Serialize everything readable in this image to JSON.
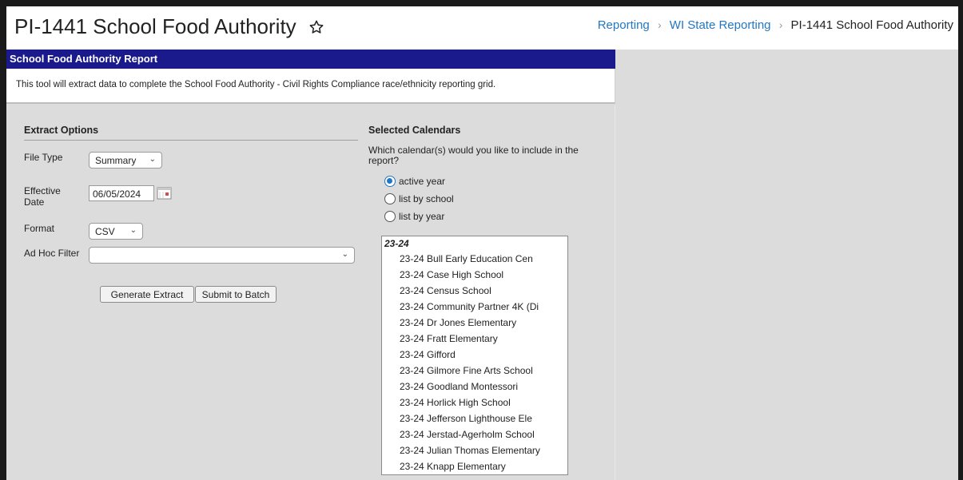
{
  "header": {
    "title": "PI-1441 School Food Authority",
    "breadcrumb": [
      {
        "label": "Reporting"
      },
      {
        "label": "WI State Reporting"
      },
      {
        "label": "PI-1441 School Food Authority"
      }
    ]
  },
  "report": {
    "title": "School Food Authority Report",
    "description": "This tool will extract data to complete the School Food Authority - Civil Rights Compliance race/ethnicity reporting grid."
  },
  "extract_options": {
    "heading": "Extract Options",
    "file_type_label": "File Type",
    "file_type_value": "Summary",
    "effective_date_label": "Effective Date",
    "effective_date_value": "06/05/2024",
    "format_label": "Format",
    "format_value": "CSV",
    "ad_hoc_label": "Ad Hoc Filter",
    "ad_hoc_value": "",
    "generate_button": "Generate Extract",
    "batch_button": "Submit to Batch"
  },
  "calendars": {
    "heading": "Selected Calendars",
    "question": "Which calendar(s) would you like to include in the report?",
    "options": [
      {
        "label": "active year",
        "checked": true
      },
      {
        "label": "list by school",
        "checked": false
      },
      {
        "label": "list by year",
        "checked": false
      }
    ],
    "group": "23-24",
    "items": [
      "23-24 Bull Early Education Cen",
      "23-24 Case High School",
      "23-24 Census School",
      "23-24 Community Partner 4K (Di",
      "23-24 Dr Jones Elementary",
      "23-24 Fratt Elementary",
      "23-24 Gifford",
      "23-24 Gilmore Fine Arts School",
      "23-24 Goodland Montessori",
      "23-24 Horlick High School",
      "23-24 Jefferson Lighthouse Ele",
      "23-24 Jerstad-Agerholm School",
      "23-24 Julian Thomas Elementary",
      "23-24 Knapp Elementary"
    ]
  }
}
